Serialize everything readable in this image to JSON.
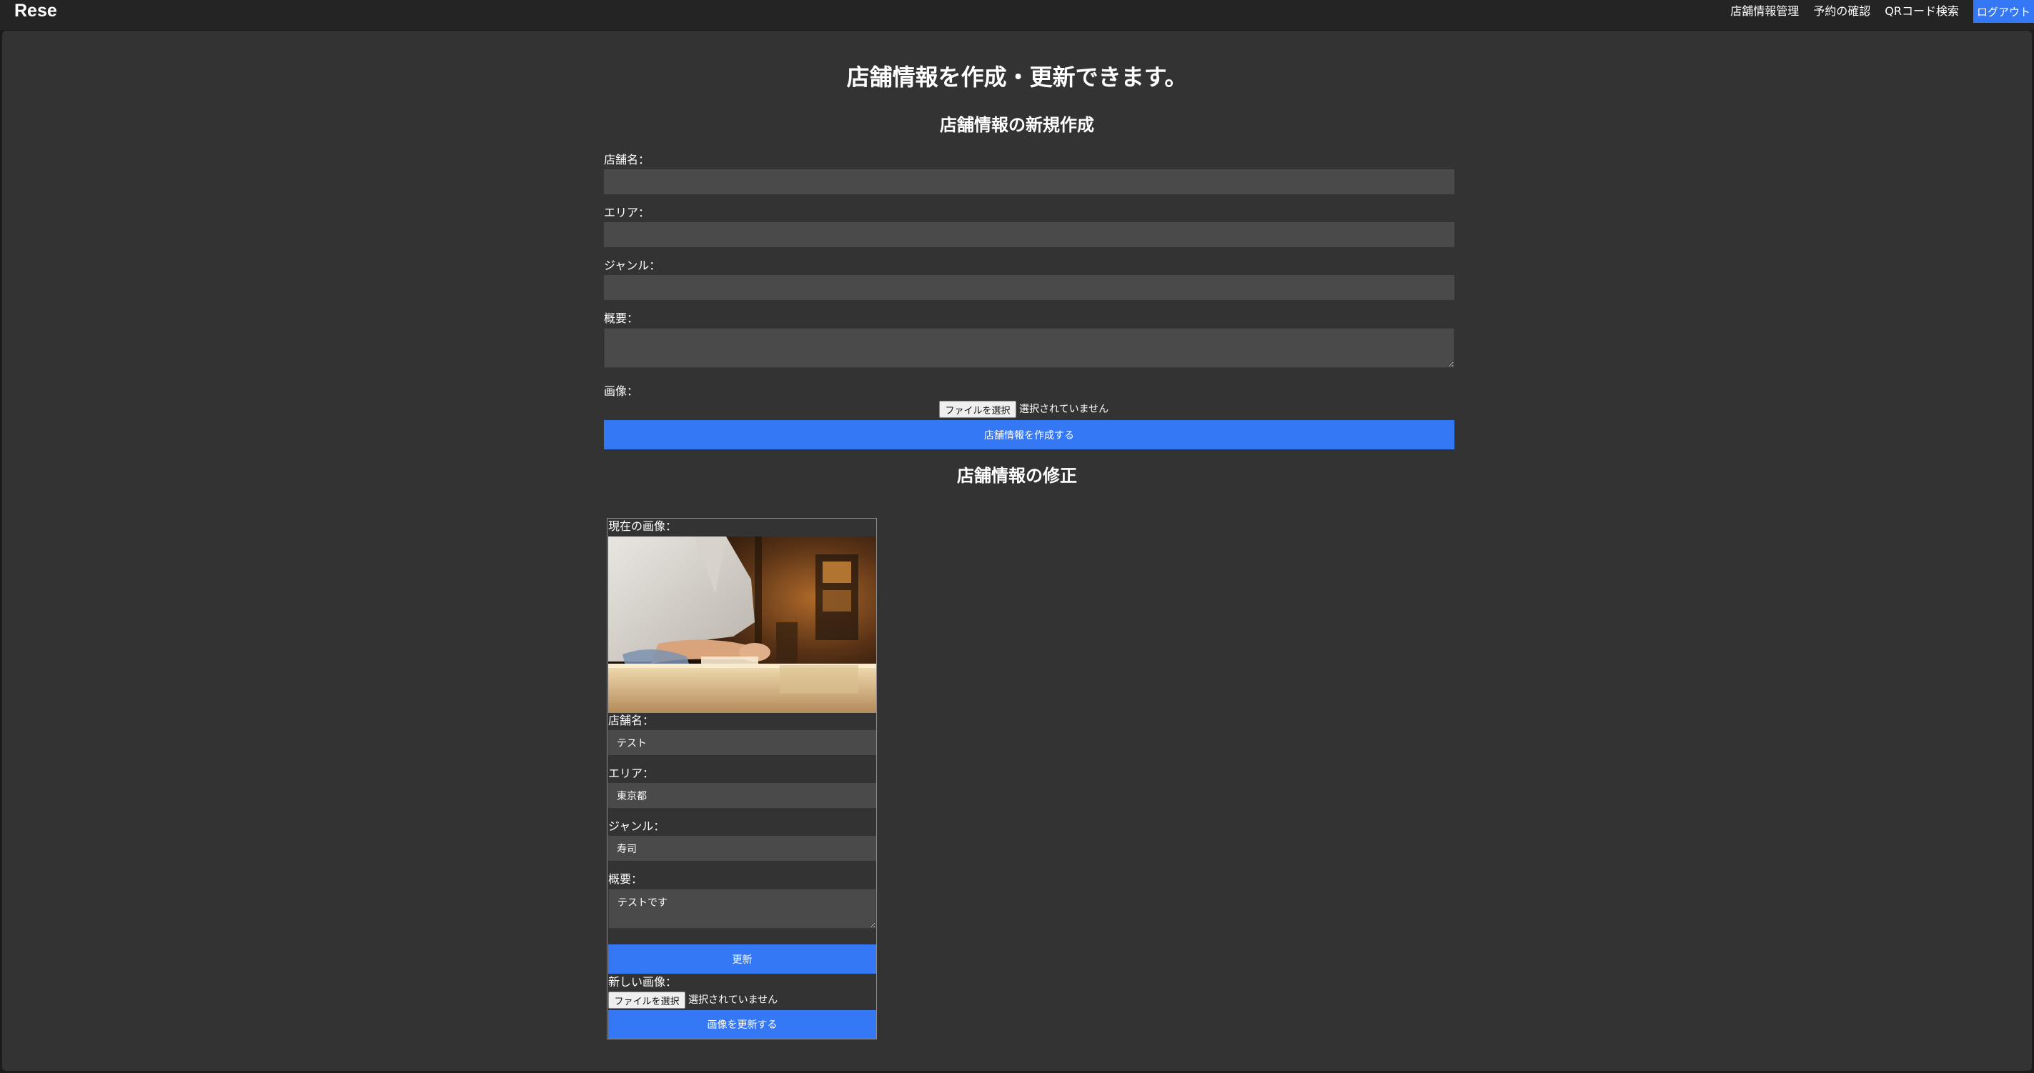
{
  "header": {
    "logo": "Rese",
    "nav": {
      "shop_management": "店舗情報管理",
      "reservations": "予約の確認",
      "qr_search": "QRコード検索",
      "logout": "ログアウト"
    }
  },
  "page": {
    "heading": "店舗情報を作成・更新できます。"
  },
  "create_form": {
    "heading": "店舗情報の新規作成",
    "name_label": "店舗名：",
    "name_value": "",
    "area_label": "エリア：",
    "area_value": "",
    "genre_label": "ジャンル：",
    "genre_value": "",
    "summary_label": "概要：",
    "summary_value": "",
    "image_label": "画像：",
    "file_button": "ファイルを選択",
    "file_status": "選択されていません",
    "submit_button": "店舗情報を作成する"
  },
  "edit_form": {
    "heading": "店舗情報の修正",
    "current_image_label": "現在の画像：",
    "name_label": "店舗名：",
    "name_value": "テスト",
    "area_label": "エリア：",
    "area_value": "東京都",
    "genre_label": "ジャンル：",
    "genre_value": "寿司",
    "summary_label": "概要：",
    "summary_value": "テストです",
    "update_button": "更新",
    "new_image_label": "新しい画像：",
    "file_button": "ファイルを選択",
    "file_status": "選択されていません",
    "update_image_button": "画像を更新する"
  },
  "colors": {
    "accent": "#3478f6",
    "background": "#333333",
    "input_background": "#4a4a4a",
    "header_background": "#242424"
  },
  "icons": {
    "shop_photo": "sushi-chef-photo"
  }
}
